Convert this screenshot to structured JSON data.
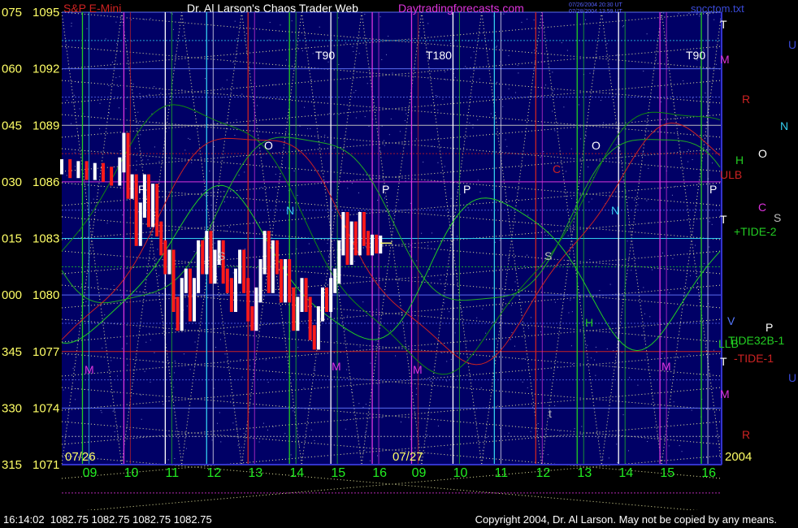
{
  "chart_data": {
    "type": "line",
    "title": "Dr. Al Larson's Chaos Trader Web",
    "instrument": "S&P E-Mini",
    "website": "Daytradingforecasts.com",
    "stamp_lines": [
      "07/26/2004 20:30 UT",
      "07/28/2004 13:59 UT"
    ],
    "filename": "spcctom.txt",
    "year": "2004",
    "dates": [
      "07/26",
      "07/27"
    ],
    "x_ticks": [
      "09",
      "10",
      "11",
      "12",
      "13",
      "14",
      "15",
      "16",
      "09",
      "10",
      "11",
      "12",
      "13",
      "14",
      "15",
      "16"
    ],
    "y_left_degrees": [
      "075",
      "060",
      "045",
      "030",
      "015",
      "000",
      "345",
      "330",
      "315"
    ],
    "y_left_prices": [
      "1095",
      "1092",
      "1089",
      "1086",
      "1083",
      "1080",
      "1077",
      "1074",
      "1071"
    ],
    "ylim": [
      1071,
      1095
    ],
    "right_labels": [
      {
        "text": "T",
        "color": "#ffffff"
      },
      {
        "text": "U",
        "color": "#3a4ad8"
      },
      {
        "text": "M",
        "color": "#dd33dd"
      },
      {
        "text": "R",
        "color": "#cc2222"
      },
      {
        "text": "N",
        "color": "#33ccee"
      },
      {
        "text": "O",
        "color": "#ffffff"
      },
      {
        "text": "H",
        "color": "#22cc22"
      },
      {
        "text": "ULB",
        "color": "#cc2222"
      },
      {
        "text": "C",
        "color": "#dd33dd"
      },
      {
        "text": "T",
        "color": "#ffffff"
      },
      {
        "text": "S",
        "color": "#bbbbbb"
      },
      {
        "text": "+TIDE-2",
        "color": "#22cc22"
      },
      {
        "text": "P",
        "color": "#ffffff"
      },
      {
        "text": "V",
        "color": "#5577ff"
      },
      {
        "text": "LLB",
        "color": "#22cc22"
      },
      {
        "text": "TIDE32B-1",
        "color": "#22cc22"
      },
      {
        "text": "T",
        "color": "#ffffff"
      },
      {
        "text": "-TIDE-1",
        "color": "#cc2222"
      },
      {
        "text": "U",
        "color": "#3a4ad8"
      },
      {
        "text": "M",
        "color": "#dd33dd"
      },
      {
        "text": "R",
        "color": "#cc2222"
      }
    ],
    "annotations": [
      {
        "text": "T90",
        "color": "#ffffff"
      },
      {
        "text": "T180",
        "color": "#ffffff"
      },
      {
        "text": "T90",
        "color": "#ffffff"
      },
      {
        "text": "P",
        "color": "#ffffff"
      },
      {
        "text": "P",
        "color": "#ffffff"
      },
      {
        "text": "P",
        "color": "#ffffff"
      },
      {
        "text": "P",
        "color": "#ffffff"
      },
      {
        "text": "O",
        "color": "#ffffff"
      },
      {
        "text": "O",
        "color": "#ffffff"
      },
      {
        "text": "N",
        "color": "#33ccee"
      },
      {
        "text": "N",
        "color": "#33ccee"
      },
      {
        "text": "S",
        "color": "#bbbbbb"
      },
      {
        "text": "S",
        "color": "#bbbbbb"
      },
      {
        "text": "C",
        "color": "#cc2222"
      },
      {
        "text": "M",
        "color": "#dd33dd"
      },
      {
        "text": "M",
        "color": "#dd33dd"
      },
      {
        "text": "M",
        "color": "#dd33dd"
      },
      {
        "text": "M",
        "color": "#dd33dd"
      },
      {
        "text": "H",
        "color": "#22cc22"
      },
      {
        "text": "t",
        "color": "#bbbbbb"
      }
    ],
    "price_series": {
      "name": "S&P E-Mini",
      "x": [
        8.3,
        8.5,
        8.7,
        8.9,
        9.1,
        9.3,
        9.5,
        9.7,
        9.8,
        9.9,
        10.0,
        10.1,
        10.2,
        10.3,
        10.4,
        10.5,
        10.6,
        10.7,
        10.8,
        10.9,
        11.0,
        11.1,
        11.2,
        11.3,
        11.4,
        11.5,
        11.6,
        11.7,
        11.8,
        11.9,
        12.0,
        12.1,
        12.2,
        12.3,
        12.4,
        12.5,
        12.6,
        12.7,
        12.8,
        12.9,
        13.0,
        13.1,
        13.2,
        13.3,
        13.4,
        13.5,
        13.6,
        13.7,
        13.8,
        13.9,
        14.0,
        14.1,
        14.2,
        14.3,
        14.4,
        14.5,
        14.6,
        14.7,
        14.8,
        14.9,
        15.0,
        15.1,
        15.2,
        15.3,
        15.4,
        15.5,
        15.6,
        15.7,
        15.8,
        15.9,
        16.0
      ],
      "values": [
        1086.8,
        1086.6,
        1086.7,
        1086.5,
        1086.6,
        1086.4,
        1086.2,
        1086.9,
        1088.2,
        1085.5,
        1086.0,
        1083.0,
        1084.5,
        1086.0,
        1084.0,
        1085.5,
        1083.5,
        1082.5,
        1081.5,
        1082.0,
        1079.5,
        1078.5,
        1080.5,
        1081.0,
        1079.0,
        1080.5,
        1082.5,
        1081.5,
        1083.0,
        1081.0,
        1082.0,
        1082.5,
        1081.0,
        1080.5,
        1079.5,
        1081.0,
        1082.0,
        1080.5,
        1079.0,
        1078.5,
        1080.0,
        1081.5,
        1083.0,
        1080.5,
        1082.5,
        1081.5,
        1080.0,
        1081.5,
        1080.0,
        1078.5,
        1079.5,
        1080.5,
        1079.5,
        1078.0,
        1077.5,
        1079.0,
        1080.0,
        1079.5,
        1080.5,
        1081.0,
        1082.5,
        1084.0,
        1082.0,
        1083.5,
        1082.5,
        1084.0,
        1083.0,
        1082.5,
        1082.8,
        1082.6,
        1082.75
      ]
    },
    "ohlc_readout": [
      "16:14:02",
      "1082.75",
      "1082.75",
      "1082.75",
      "1082.75"
    ],
    "copyright": "Copyright 2004, Dr. Al Larson. May not be copied by any means."
  }
}
